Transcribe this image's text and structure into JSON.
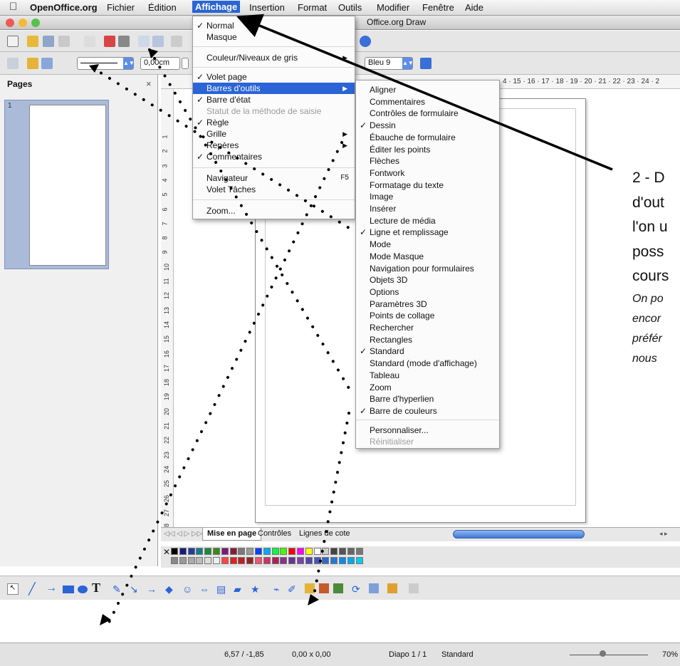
{
  "menubar": {
    "app_name": "OpenOffice.org",
    "items": [
      "Fichier",
      "Édition",
      "Affichage",
      "Insertion",
      "Format",
      "Outils",
      "Modifier",
      "Fenêtre",
      "Aide"
    ],
    "active": "Affichage"
  },
  "window": {
    "title": "Office.org Draw"
  },
  "toolbar2": {
    "width_value": "0,00cm",
    "color_value": "Bleu 9"
  },
  "pages_panel": {
    "title": "Pages",
    "close": "×",
    "page_number": "1"
  },
  "ruler_h_numbers": "4 · 15 · 16 · 17 · 18 · 19 · 20 · 21 · 22 · 23 · 24 · 2",
  "ruler_v_numbers": [
    "1",
    "2",
    "3",
    "4",
    "5",
    "6",
    "7",
    "8",
    "9",
    "10",
    "11",
    "12",
    "13",
    "14",
    "15",
    "16",
    "17",
    "18",
    "19",
    "20",
    "21",
    "22",
    "23",
    "24",
    "25",
    "26",
    "27",
    "28",
    "29"
  ],
  "affichage_menu": {
    "items": [
      {
        "label": "Normal",
        "checked": true
      },
      {
        "label": "Masque",
        "checked": false
      },
      {
        "label": "Couleur/Niveaux de gris",
        "submenu": true
      },
      {
        "label": "Volet page",
        "checked": true
      },
      {
        "label": "Barres d'outils",
        "submenu": true,
        "selected": true
      },
      {
        "label": "Barre d'état",
        "checked": true
      },
      {
        "label": "Statut de la méthode de saisie",
        "disabled": true
      },
      {
        "label": "Règle",
        "checked": true
      },
      {
        "label": "Grille",
        "submenu": true
      },
      {
        "label": "Repères",
        "submenu": true
      },
      {
        "label": "Commentaires",
        "checked": true
      },
      {
        "label": "Navigateur",
        "shortcut": "F5"
      },
      {
        "label": "Volet Tâches"
      },
      {
        "label": "Zoom..."
      }
    ]
  },
  "toolbars_submenu": {
    "items": [
      {
        "label": "Aligner"
      },
      {
        "label": "Commentaires"
      },
      {
        "label": "Contrôles de formulaire"
      },
      {
        "label": "Dessin",
        "checked": true
      },
      {
        "label": "Ébauche de formulaire"
      },
      {
        "label": "Éditer les points"
      },
      {
        "label": "Flèches"
      },
      {
        "label": "Fontwork"
      },
      {
        "label": "Formatage du texte"
      },
      {
        "label": "Image"
      },
      {
        "label": "Insérer"
      },
      {
        "label": "Lecture de média"
      },
      {
        "label": "Ligne et remplissage",
        "checked": true
      },
      {
        "label": "Mode"
      },
      {
        "label": "Mode Masque"
      },
      {
        "label": "Navigation pour formulaires"
      },
      {
        "label": "Objets 3D"
      },
      {
        "label": "Options"
      },
      {
        "label": "Paramètres 3D"
      },
      {
        "label": "Points de collage"
      },
      {
        "label": "Rechercher"
      },
      {
        "label": "Rectangles"
      },
      {
        "label": "Standard",
        "checked": true
      },
      {
        "label": "Standard (mode d'affichage)"
      },
      {
        "label": "Tableau"
      },
      {
        "label": "Zoom"
      },
      {
        "label": "Barre d'hyperlien"
      },
      {
        "label": "Barre de couleurs",
        "checked": true
      },
      {
        "label": "Personnaliser..."
      },
      {
        "label": "Réinitialiser",
        "disabled": true
      }
    ]
  },
  "tabs": [
    "Mise en page",
    "Contrôles",
    "Lignes de cote"
  ],
  "status": {
    "position": "6,57 / -1,85",
    "size": "0,00 x 0,00",
    "slide": "Diapo 1 / 1",
    "layout": "Standard",
    "zoom": "70%"
  },
  "annotation": {
    "lines": [
      "2 - D",
      "d'out",
      "l'on u",
      "poss",
      "cours"
    ],
    "italic_lines": [
      "On po",
      "encor",
      "préfér",
      "nous "
    ]
  },
  "colors": {
    "menu_highlight": "#2a64d6",
    "palette": [
      "#000000",
      "#1b1b7a",
      "#1f3f9a",
      "#17798a",
      "#1a8a3a",
      "#3a8a1a",
      "#7a1a7a",
      "#8a1a3a",
      "#7a7a7a",
      "#9a9a9a",
      "#0044ff",
      "#00aaff",
      "#00ff44",
      "#44ff00",
      "#ff0000",
      "#ff00ff",
      "#ffff00",
      "#ffffff",
      "#cccccc",
      "#444444",
      "#555555",
      "#666666",
      "#777777",
      "#888888",
      "#999999",
      "#aaaaaa",
      "#bbbbbb",
      "#dddddd",
      "#eeeeee",
      "#ff4444",
      "#dd2222",
      "#bb2222",
      "#992222",
      "#ee5577",
      "#cc3366",
      "#aa2255",
      "#883388",
      "#663399",
      "#7744aa",
      "#5544aa",
      "#4455bb",
      "#3366cc",
      "#2277dd",
      "#1188ee",
      "#00aaee",
      "#00ccee"
    ]
  }
}
